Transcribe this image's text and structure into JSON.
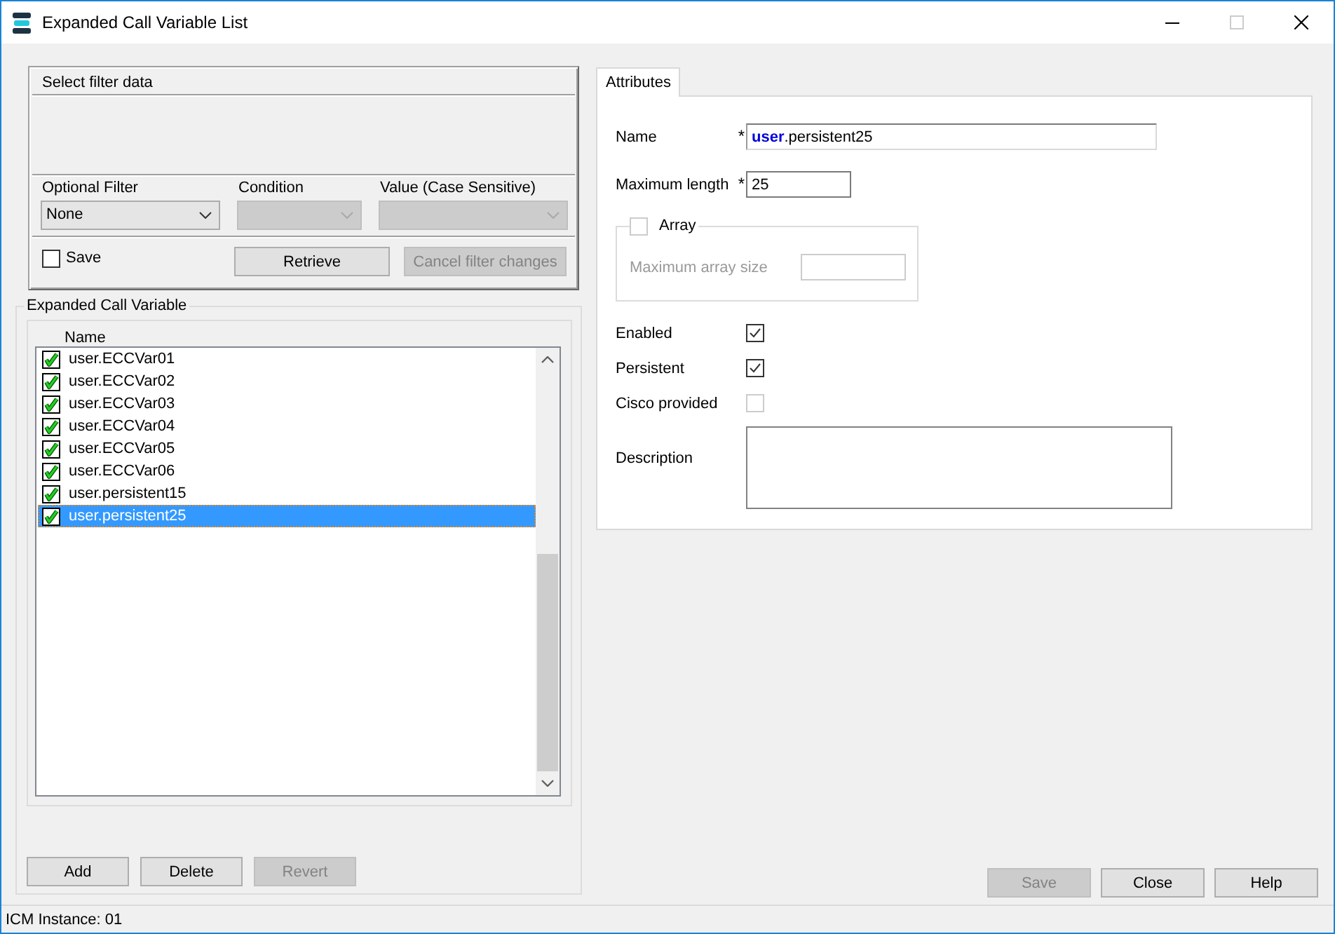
{
  "window": {
    "title": "Expanded Call Variable List",
    "controls": [
      {
        "kind": "minimize",
        "disabled": false
      },
      {
        "kind": "maximize",
        "disabled": true
      },
      {
        "kind": "close",
        "disabled": false
      }
    ]
  },
  "filter": {
    "title": "Select filter data",
    "fields": [
      {
        "label": "Optional Filter",
        "value": "None",
        "disabled": false
      },
      {
        "label": "Condition",
        "disabled": true
      },
      {
        "label": "Value (Case Sensitive)",
        "disabled": true
      }
    ],
    "save": {
      "label": "Save",
      "checked": false
    },
    "buttons": [
      {
        "label": "Retrieve",
        "disabled": false
      },
      {
        "label": "Cancel filter changes",
        "disabled": true
      }
    ]
  },
  "variables": {
    "title": "Expanded Call Variable",
    "column": "Name",
    "items": [
      {
        "name": "user.ECCVar01",
        "checked": true,
        "selected": false
      },
      {
        "name": "user.ECCVar02",
        "checked": true,
        "selected": false
      },
      {
        "name": "user.ECCVar03",
        "checked": true,
        "selected": false
      },
      {
        "name": "user.ECCVar04",
        "checked": true,
        "selected": false
      },
      {
        "name": "user.ECCVar05",
        "checked": true,
        "selected": false
      },
      {
        "name": "user.ECCVar06",
        "checked": true,
        "selected": false
      },
      {
        "name": "user.persistent15",
        "checked": true,
        "selected": false
      },
      {
        "name": "user.persistent25",
        "checked": true,
        "selected": true
      }
    ],
    "buttons": [
      {
        "label": "Add",
        "disabled": false
      },
      {
        "label": "Delete",
        "disabled": false
      },
      {
        "label": "Revert",
        "disabled": true
      }
    ]
  },
  "tabs": [
    {
      "label": "Attributes",
      "selected": true
    }
  ],
  "attributes": {
    "name": {
      "label": "Name",
      "required_mark": "*",
      "value": "**user**.persistent25"
    },
    "max_length": {
      "label": "Maximum length",
      "required_mark": "*",
      "value": "25"
    },
    "array": {
      "label": "Array",
      "checked": false,
      "disabled": true,
      "size_label": "Maximum array size"
    },
    "flags": [
      {
        "label": "Enabled",
        "checked": true,
        "disabled": false
      },
      {
        "label": "Persistent",
        "checked": true,
        "disabled": false
      },
      {
        "label": "Cisco provided",
        "checked": false,
        "disabled": true
      }
    ],
    "description": {
      "label": "Description"
    }
  },
  "dialog_buttons": [
    {
      "label": "Save",
      "disabled": true
    },
    {
      "label": "Close",
      "disabled": false
    },
    {
      "label": "Help",
      "disabled": false
    }
  ],
  "status_bar": {
    "text": "ICM Instance: 01"
  }
}
